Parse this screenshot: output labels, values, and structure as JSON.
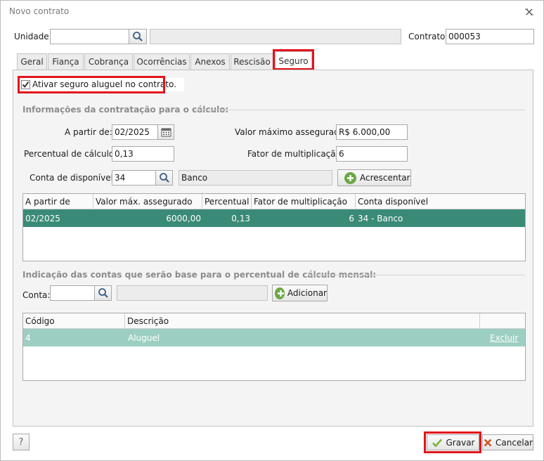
{
  "window": {
    "title": "Novo contrato"
  },
  "header": {
    "unidade_label": "Unidade:",
    "unidade_value": "",
    "unidade_desc": "",
    "contrato_label": "Contrato:",
    "contrato_value": "000053"
  },
  "tabs": [
    {
      "label": "Geral"
    },
    {
      "label": "Fiança"
    },
    {
      "label": "Cobrança"
    },
    {
      "label": "Ocorrências"
    },
    {
      "label": "Anexos"
    },
    {
      "label": "Rescisão"
    },
    {
      "label": "Seguro"
    }
  ],
  "seguro": {
    "activate_label": "Ativar seguro aluguel no contrato.",
    "activate_checked": true,
    "section1_title": "Informações da contratação para o cálculo:",
    "a_partir_label": "A partir de:",
    "a_partir_value": "02/2025",
    "valor_max_label": "Valor máximo assegurado:",
    "valor_max_value": "R$ 6.000,00",
    "percentual_label": "Percentual de cálculo:",
    "percentual_value": "0,13",
    "fator_label": "Fator de multiplicação:",
    "fator_value": "6",
    "conta_disp_label": "Conta de disponível:",
    "conta_disp_value": "34",
    "conta_disp_desc": "Banco",
    "acrescentar_label": "Acrescentar",
    "table1": {
      "columns": [
        "A partir de",
        "Valor máx. assegurado",
        "Percentual",
        "Fator de multiplicação",
        "Conta disponível"
      ],
      "rows": [
        [
          "02/2025",
          "6000,00",
          "0,13",
          "6",
          "34 - Banco"
        ]
      ]
    },
    "section2_title": "Indicação das contas que serão base para o percentual de cálculo mensal:",
    "conta_label": "Conta:",
    "conta_value": "",
    "conta_desc": "",
    "adicionar_label": "Adicionar",
    "table2": {
      "columns": [
        "Código",
        "Descrição",
        ""
      ],
      "rows": [
        [
          "4",
          "Aluguel",
          "Excluir"
        ]
      ]
    }
  },
  "footer": {
    "help_label": "?",
    "gravar_label": "Gravar",
    "cancelar_label": "Cancelar"
  },
  "colors": {
    "selected_row": "#3a8a78",
    "teal_row": "#9ccfc2",
    "highlight_box": "#e3141b"
  }
}
